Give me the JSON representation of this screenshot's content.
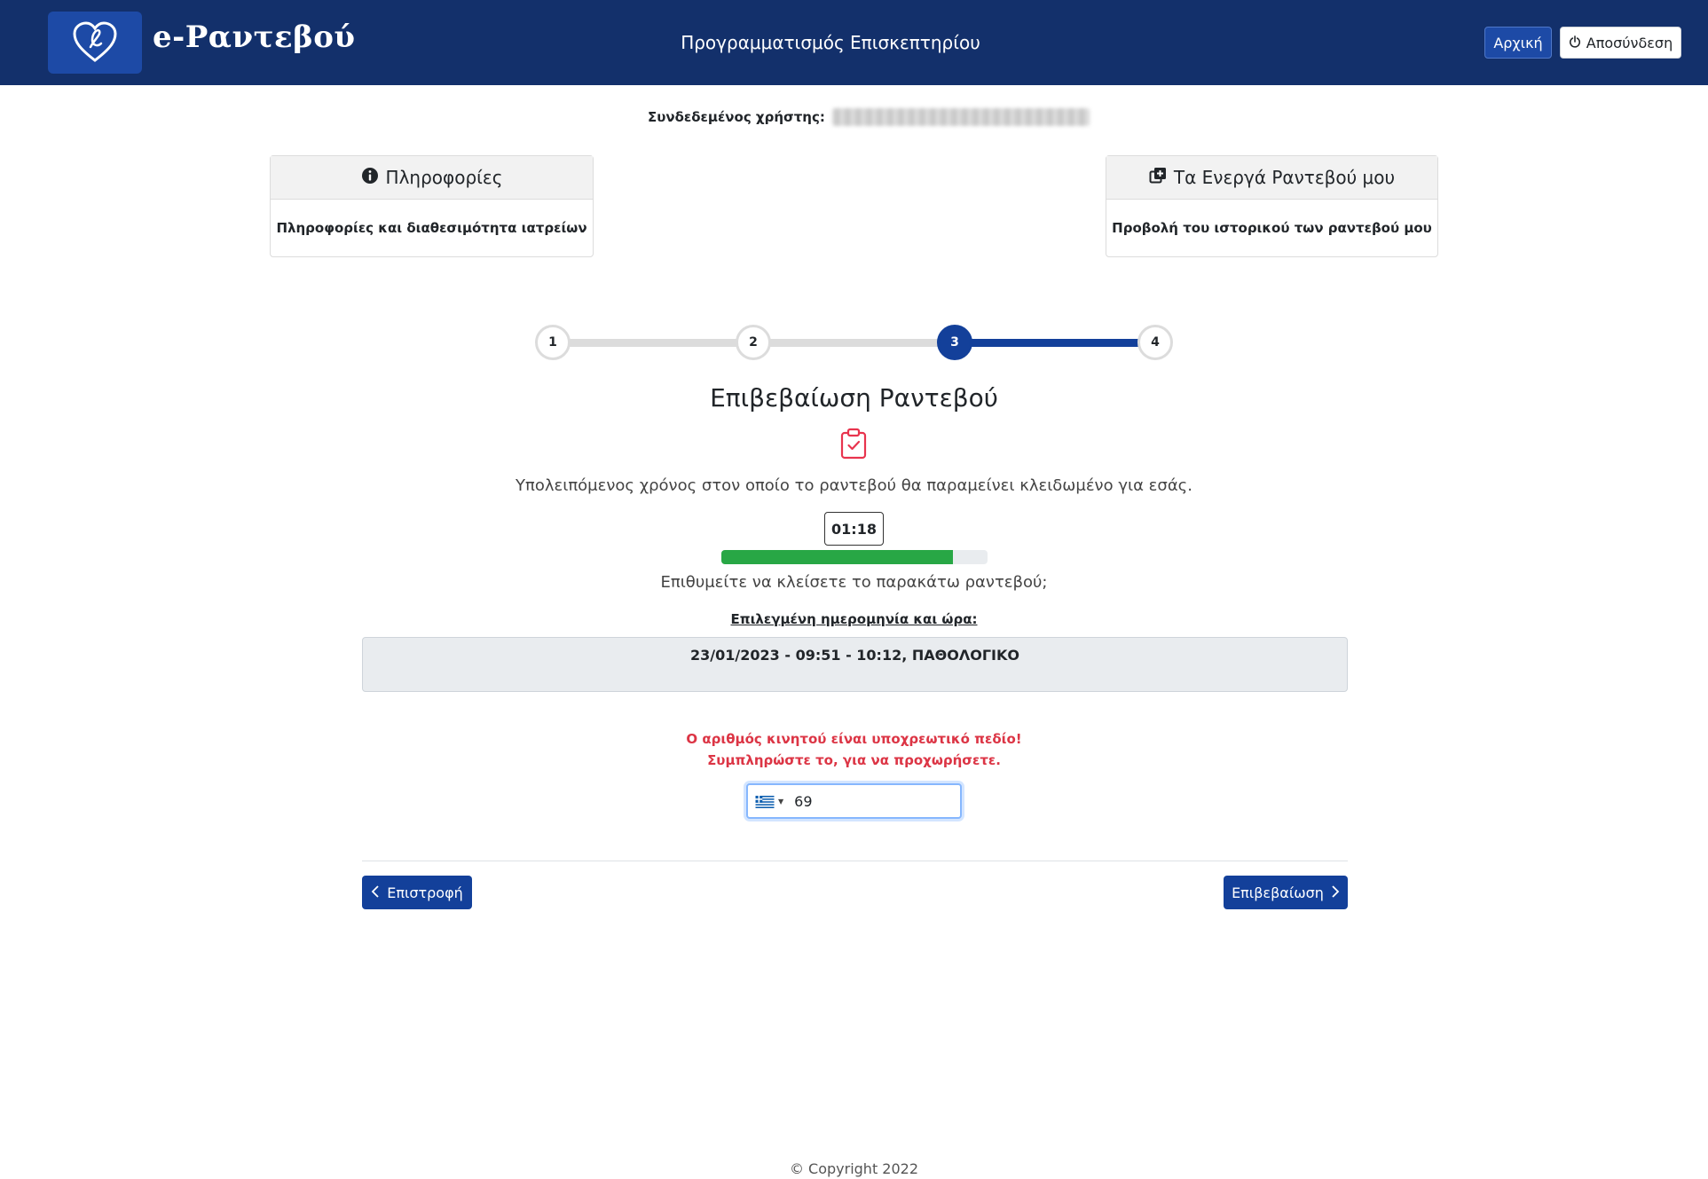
{
  "header": {
    "logo_text": "e-Ραντεβού",
    "page_title": "Προγραμματισμός Επισκεπτηρίου",
    "home_label": "Αρχική",
    "logout_label": "Αποσύνδεση"
  },
  "user": {
    "label": "Συνδεδεμένος χρήστης:"
  },
  "cards": {
    "info": {
      "title": "Πληροφορίες",
      "body": "Πληροφορίες και διαθεσιμότητα ιατρείων"
    },
    "active": {
      "title": "Τα Ενεργά Ραντεβού μου",
      "body": "Προβολή του ιστορικού των ραντεβού μου"
    }
  },
  "stepper": {
    "steps": [
      "1",
      "2",
      "3",
      "4"
    ],
    "current_step": 3
  },
  "confirmation": {
    "title": "Επιβεβαίωση Ραντεβού",
    "remaining_text": "Υπολειπόμενος χρόνος στον οποίο το ραντεβού θα παραμείνει κλειδωμένο για εσάς.",
    "timer": "01:18",
    "progress_fraction": 0.87,
    "question": "Επιθυμείτε να κλείσετε το παρακάτω ραντεβού;",
    "selected_label": "Επιλεγμένη ημερομηνία και ώρα:",
    "selected_value": "23/01/2023 - 09:51 - 10:12, ΠΑΘΟΛΟΓΙΚΟ"
  },
  "phone": {
    "error_line1": "Ο αριθμός κινητού είναι υποχρεωτικό πεδίο!",
    "error_line2": "Συμπληρώστε το, για να προχωρήσετε.",
    "value": "69"
  },
  "actions": {
    "back_label": "Επιστροφή",
    "confirm_label": "Επιβεβαίωση"
  },
  "footer": {
    "copyright": "© Copyright 2022"
  },
  "colors": {
    "navbar": "#13306b",
    "primary": "#13409a",
    "progress": "#28a745",
    "error": "#dc3545"
  },
  "icons": [
    "heart-logo-icon",
    "power-icon",
    "info-circle-icon",
    "copy-plus-icon",
    "clipboard-check-icon",
    "greek-flag-icon",
    "chevron-left-icon",
    "chevron-right-icon"
  ]
}
